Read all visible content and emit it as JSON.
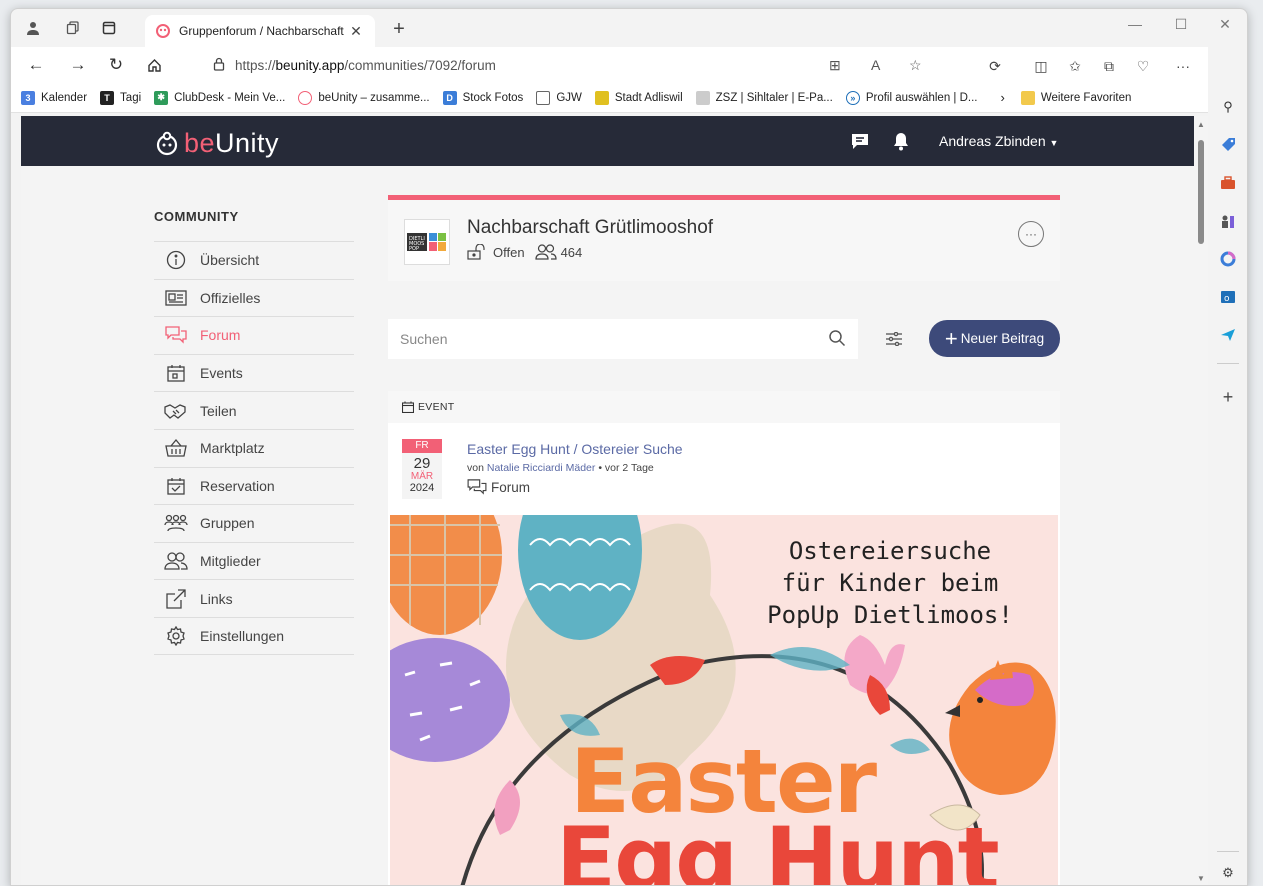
{
  "browser": {
    "tab_title": "Gruppenforum / Nachbarschaft G",
    "url_prefix": "https://",
    "url_host": "beunity.app",
    "url_path": "/communities/7092/forum"
  },
  "bookmarks": [
    {
      "label": "Kalender",
      "color": "#4a7fe0"
    },
    {
      "label": "Tagi",
      "color": "#222222"
    },
    {
      "label": "ClubDesk - Mein Ve...",
      "color": "#2e9b5a"
    },
    {
      "label": "beUnity – zusamme...",
      "color": "#f26076"
    },
    {
      "label": "Stock Fotos",
      "color": "#3b7dd8"
    },
    {
      "label": "GJW",
      "color": "#666666"
    },
    {
      "label": "Stadt Adliswil",
      "color": "#2e8b57"
    },
    {
      "label": "ZSZ | Sihltaler | E-Pa...",
      "color": "#999999"
    },
    {
      "label": "Profil auswählen | D...",
      "color": "#1e6fb8"
    }
  ],
  "bookmarks_more": "Weitere Favoriten",
  "app": {
    "logo_prefix": "be",
    "logo_suffix": "Unity",
    "user_name": "Andreas Zbinden"
  },
  "sidebar": {
    "title": "COMMUNITY",
    "items": [
      {
        "label": "Übersicht",
        "icon": "info-icon"
      },
      {
        "label": "Offizielles",
        "icon": "newspaper-icon"
      },
      {
        "label": "Forum",
        "icon": "chat-icon"
      },
      {
        "label": "Events",
        "icon": "calendar-icon"
      },
      {
        "label": "Teilen",
        "icon": "handshake-icon"
      },
      {
        "label": "Marktplatz",
        "icon": "basket-icon"
      },
      {
        "label": "Reservation",
        "icon": "calendar-check-icon"
      },
      {
        "label": "Gruppen",
        "icon": "groups-icon"
      },
      {
        "label": "Mitglieder",
        "icon": "members-icon"
      },
      {
        "label": "Links",
        "icon": "external-link-icon"
      },
      {
        "label": "Einstellungen",
        "icon": "gear-icon"
      }
    ]
  },
  "community": {
    "name": "Nachbarschaft Grütlimooshof",
    "visibility": "Offen",
    "member_count": "464"
  },
  "search": {
    "placeholder": "Suchen"
  },
  "new_post_label": "Neuer Beitrag",
  "post": {
    "type_label": "EVENT",
    "date_dow": "FR",
    "date_day": "29",
    "date_month": "MÄR",
    "date_year": "2024",
    "title": "Easter Egg Hunt / Ostereier Suche",
    "by_prefix": "von",
    "author": "Natalie Ricciardi Mäder",
    "time": "• vor 2 Tage",
    "category": "Forum"
  },
  "poster": {
    "text_line1": "Ostereiersuche",
    "text_line2": "für Kinder beim",
    "text_line3": "PopUp Dietlimoos!",
    "title_line1": "Easter",
    "title_line2": "Egg Hunt"
  },
  "colors": {
    "accent": "#f26076",
    "navbar": "#262a38",
    "button": "#3d4a7a",
    "link": "#5b6aa5"
  }
}
